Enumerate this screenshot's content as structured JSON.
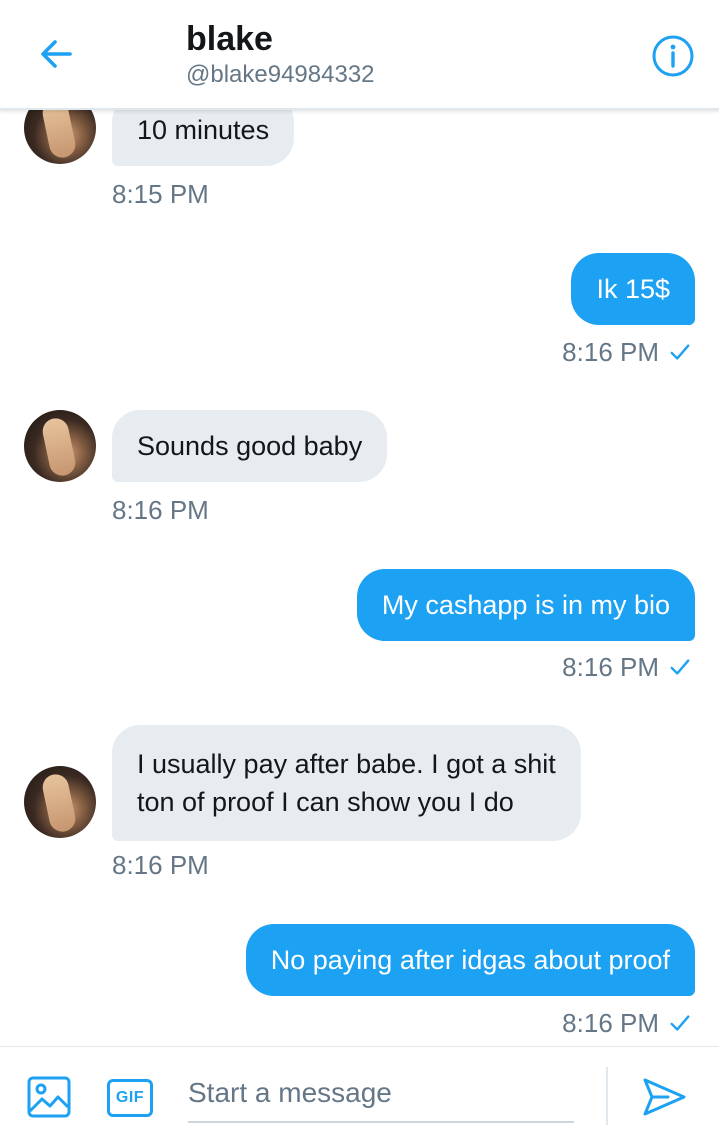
{
  "header": {
    "title": "blake",
    "handle": "@blake94984332"
  },
  "messages": [
    {
      "direction": "in",
      "text": "10 minutes",
      "time": "8:15 PM"
    },
    {
      "direction": "out",
      "text": "Ik 15$",
      "time": "8:16 PM"
    },
    {
      "direction": "in",
      "text": "Sounds good baby",
      "time": "8:16 PM"
    },
    {
      "direction": "out",
      "text": "My cashapp is in my bio",
      "time": "8:16 PM"
    },
    {
      "direction": "in",
      "lines": [
        "I usually pay after babe. I got a shit",
        "ton of proof I can show you I do"
      ],
      "time": "8:16 PM"
    },
    {
      "direction": "out",
      "text": "No paying after idgas about proof",
      "time": "8:16 PM"
    }
  ],
  "composer": {
    "gif_label": "GIF",
    "placeholder": "Start a message"
  },
  "colors": {
    "accent": "#1da1f2",
    "incoming_bubble": "#e6ecf0",
    "secondary_text": "#657786"
  },
  "icons": {
    "back": "arrow-left-icon",
    "info": "info-icon",
    "media": "image-icon",
    "send": "send-icon",
    "read": "checkmark-icon"
  }
}
